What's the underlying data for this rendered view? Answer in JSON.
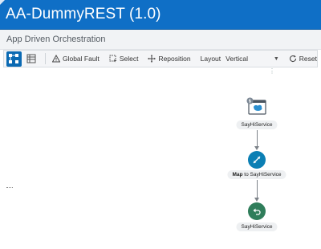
{
  "app": {
    "title": "AA-DummyREST (1.0)",
    "subtitle": "App Driven Orchestration"
  },
  "toolbar": {
    "global_fault_label": "Global Fault",
    "select_label": "Select",
    "reposition_label": "Reposition",
    "layout_label": "Layout",
    "layout_value": "Vertical",
    "reset_label": "Reset"
  },
  "flow": {
    "trigger_label": "SayHiService",
    "map_label_bold": "Map",
    "map_label_rest": " to SayHiService",
    "return_label": "SayHiService"
  },
  "colors": {
    "header": "#0f6fc6",
    "map_node": "#0b7fb4",
    "return_node": "#2f7d5a"
  }
}
